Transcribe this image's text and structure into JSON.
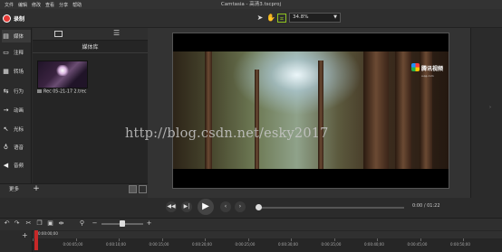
{
  "menu": [
    "文件",
    "编辑",
    "修改",
    "查看",
    "分享",
    "帮助"
  ],
  "window_title": "Camtasia - 高清3.tscproj",
  "toolbar": {
    "record_label": "录制",
    "tools": [
      "pointer-icon",
      "hand-icon",
      "crop-icon"
    ],
    "zoom_value": "34.8%"
  },
  "left_nav": [
    {
      "label": "媒体",
      "icon": "film-icon"
    },
    {
      "label": "注释",
      "icon": "callout-icon"
    },
    {
      "label": "转场",
      "icon": "transition-icon"
    },
    {
      "label": "行为",
      "icon": "behavior-icon"
    },
    {
      "label": "动画",
      "icon": "animation-icon"
    },
    {
      "label": "光标",
      "icon": "cursor-icon"
    },
    {
      "label": "语音",
      "icon": "microphone-icon"
    },
    {
      "label": "音频",
      "icon": "speaker-icon"
    }
  ],
  "media_bin": {
    "title": "媒体库",
    "items": [
      {
        "label": "Rec 05-21-17 2.trec"
      }
    ]
  },
  "bin_footer": {
    "more_label": "更多"
  },
  "canvas": {
    "logo_text": "腾讯视频",
    "logo_sub": "v.qq.com",
    "watermark": "http://blog.csdn.net/esky2017"
  },
  "playback": {
    "time_current": "0:00",
    "time_total": "01:22",
    "position": 0
  },
  "timeline": {
    "zoom_level": 0.5,
    "playhead_time": "0:00:00;00",
    "ticks": [
      "0:00:00;00",
      "0:00:05;00",
      "0:00:10;00",
      "0:00:15;00",
      "0:00:20;00",
      "0:00:25;00",
      "0:00:30;00",
      "0:00:35;00",
      "0:00:40;00",
      "0:00:45;00",
      "0:00:50;00"
    ]
  },
  "colors": {
    "record": "#e53935",
    "playhead": "#c62828",
    "accent": "#8fc31f"
  }
}
